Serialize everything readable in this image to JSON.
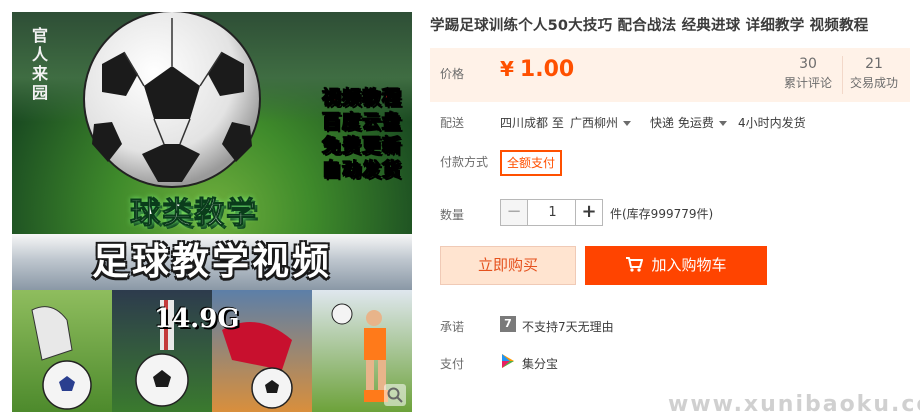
{
  "image": {
    "seal": "官人来园",
    "tags": [
      {
        "text": "视频教程",
        "color": "#ff2a2a"
      },
      {
        "text": "百度云盘",
        "color": "#ffffff"
      },
      {
        "text": "免费更新",
        "color": "#ffffff"
      },
      {
        "text": "自动发货",
        "color": "#ffffff"
      }
    ],
    "ball_kind": "球类教学",
    "big_title": "足球教学视频",
    "size": "14.9G"
  },
  "product": {
    "title": "学踢足球训练个人50大技巧 配合战法 经典进球 详细教学 视频教程"
  },
  "price": {
    "label": "价格",
    "currency": "¥",
    "value": "1.00",
    "reviews_count": "30",
    "reviews_label": "累计评论",
    "sold_count": "21",
    "sold_label": "交易成功",
    "accent_color": "#ff5000"
  },
  "delivery": {
    "label": "配送",
    "from": "四川成都 至",
    "to": "广西柳州",
    "method": "快递 免运费",
    "ship_time": "4小时内发货"
  },
  "payment_type": {
    "label": "付款方式",
    "option": "全额支付"
  },
  "quantity": {
    "label": "数量",
    "value": "1",
    "minus": "−",
    "plus": "+",
    "stock": "件(库存999779件)"
  },
  "actions": {
    "buy_now": "立即购买",
    "add_cart": "加入购物车",
    "add_cart_color": "#ff4400"
  },
  "promise": {
    "label": "承诺",
    "icon_text": "7",
    "text": "不支持7天无理由"
  },
  "pay": {
    "label": "支付",
    "method": "集分宝",
    "icon": "jifenbao-icon"
  },
  "watermark": "www.xunibaoku.com"
}
